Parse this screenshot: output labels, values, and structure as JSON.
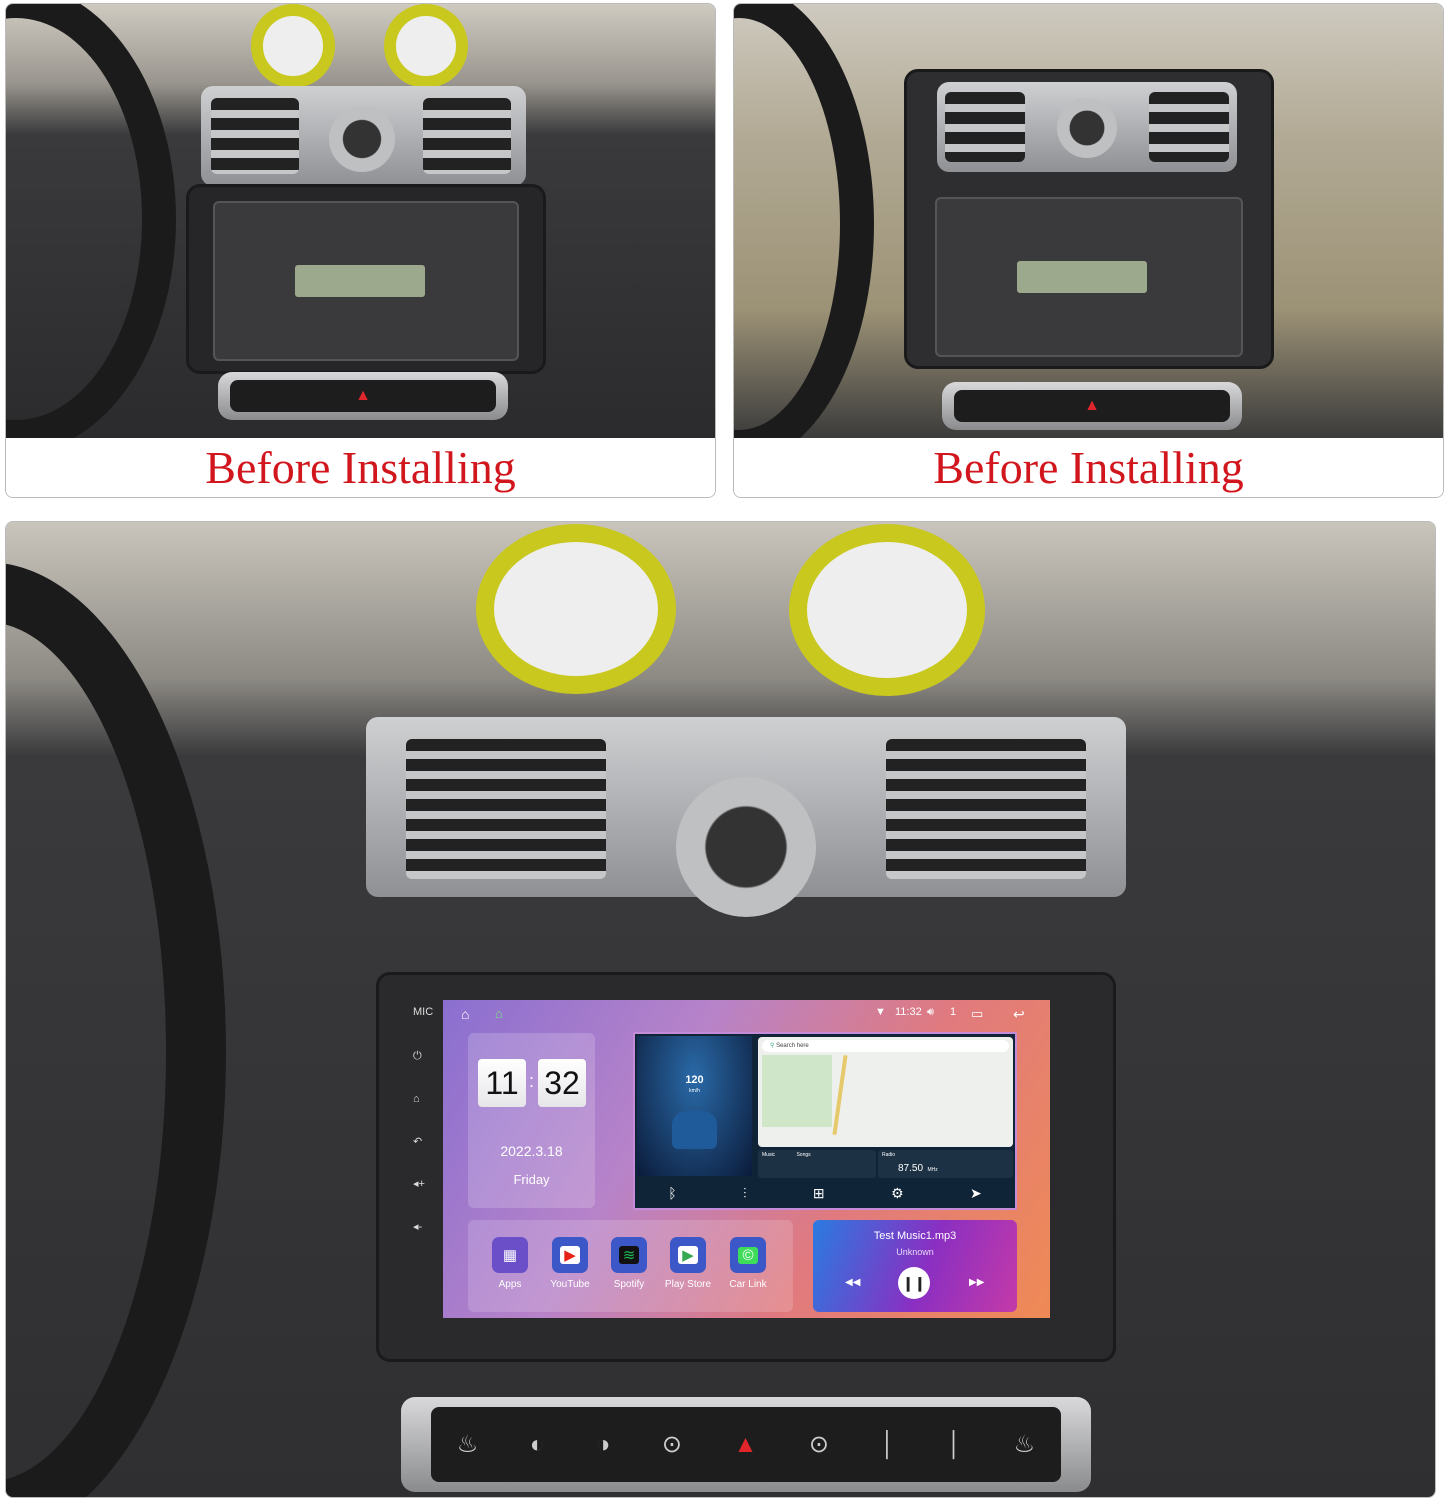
{
  "panels": {
    "top_left": {
      "caption": "Before Installing"
    },
    "top_right": {
      "caption": "Before Installing"
    }
  },
  "head_unit": {
    "status_bar": {
      "time": "11:32",
      "volume": "1",
      "icons": [
        "home-outline-icon",
        "home-icon",
        "wifi-icon",
        "volume-icon",
        "recent-apps-icon",
        "back-icon"
      ]
    },
    "clock_widget": {
      "hour": "11",
      "minute": "32",
      "separator": ":",
      "date": "2022.3.18",
      "weekday": "Friday"
    },
    "speed_widget": {
      "speed": "120",
      "unit": "km/h"
    },
    "map_widget": {
      "search_placeholder": "Search here"
    },
    "music_mini": {
      "label": "Music",
      "title": "Songs"
    },
    "radio_mini": {
      "label": "Radio",
      "frequency": "87.50",
      "unit": "MHz"
    },
    "quick_bar": [
      "bluetooth-icon",
      "equalizer-icon",
      "apps-grid-icon",
      "settings-icon",
      "navigation-icon"
    ],
    "apps": [
      {
        "label": "Apps",
        "icon": "apps-icon",
        "color": "#6a4fc8"
      },
      {
        "label": "YouTube",
        "icon": "youtube-icon",
        "color": "#e62117"
      },
      {
        "label": "Spotify",
        "icon": "spotify-icon",
        "color": "#1db954"
      },
      {
        "label": "Play Store",
        "icon": "play-store-icon",
        "color": "#34a853"
      },
      {
        "label": "Car Link",
        "icon": "car-link-icon",
        "color": "#3ddc5a"
      }
    ],
    "music_player": {
      "track": "Test Music1.mp3",
      "artist": "Unknown"
    }
  }
}
